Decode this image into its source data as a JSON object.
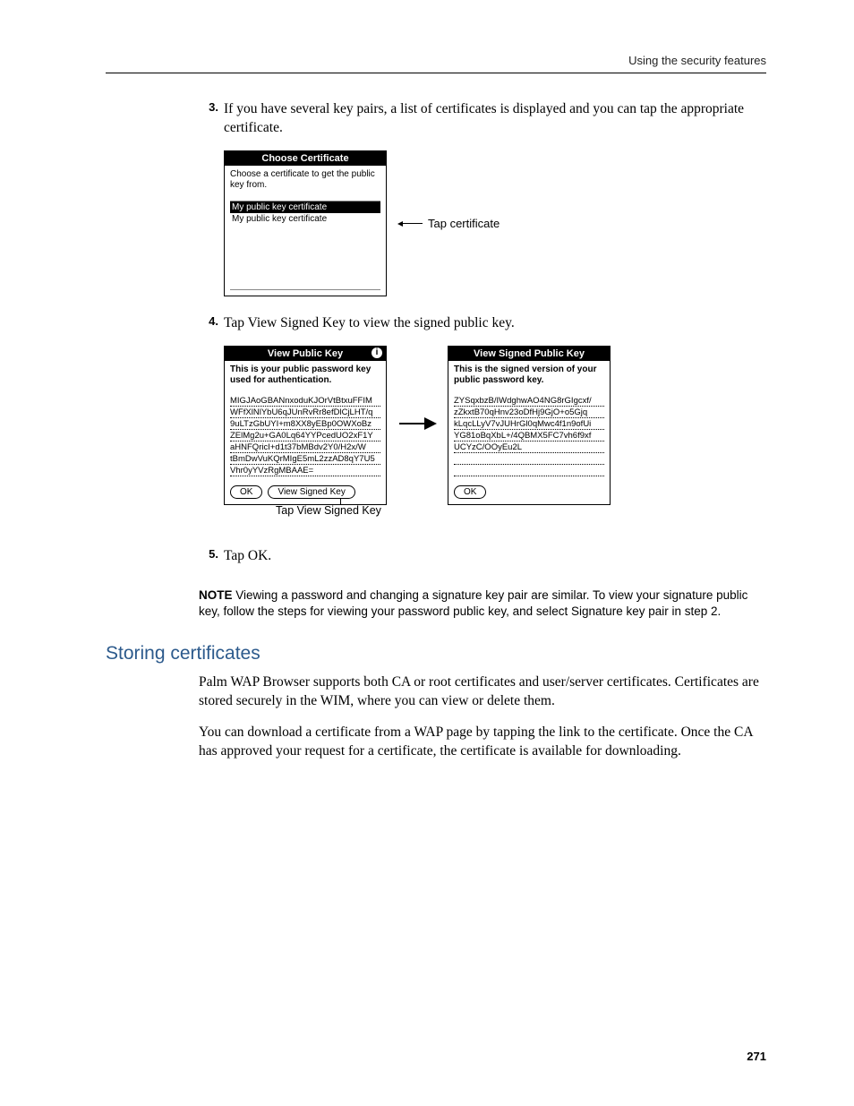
{
  "header": {
    "running": "Using the security features"
  },
  "steps": {
    "s3": {
      "num": "3.",
      "text": "If you have several key pairs, a list of certificates is displayed and you can tap the appropriate certificate."
    },
    "s4": {
      "num": "4.",
      "text": "Tap View Signed Key to view the signed public key."
    },
    "s5": {
      "num": "5.",
      "text": "Tap OK."
    }
  },
  "fig1": {
    "title": "Choose Certificate",
    "prompt": "Choose a certificate to get the public key from.",
    "items": [
      "My public key certificate",
      "My public key certificate"
    ],
    "callout": "Tap certificate"
  },
  "fig2a": {
    "title": "View Public Key",
    "prompt": "This is your public password key used for authentication.",
    "lines": [
      "MIGJAoGBANnxoduKJOrVtBtxuFFIM",
      "WFfXlNlYbU6qJUnRvRr8efDlCjLHT/q",
      "9uLTzGbUYI+m8XX8yEBp0OWXoBz",
      "ZElMg2u+GA0Lq64YYPcedUO2xF1Y",
      "aHNFQricI+d1t37bMBdv2Y0/H2x/W",
      "tBmDwVuKQrMIgE5mL2zzAD8qY7U5",
      "Vhr0yYVzRgMBAAE="
    ],
    "btn_ok": "OK",
    "btn_view": "View Signed Key"
  },
  "fig2b": {
    "title": "View Signed Public Key",
    "prompt": "This is the signed version of your public password key.",
    "lines": [
      "ZYSqxbzB/IWdghwAO4NG8rGIgcxf/",
      "zZkxtB70qHnv23oDfHj9GjO+o5Gjq",
      "kLqcLLyV7vJUHrGl0qMwc4f1n9ofUi",
      "YG81oBqXbL+/4QBMX5FC7vh6f9xf",
      "UCYzC/OOyEu2L"
    ],
    "btn_ok": "OK"
  },
  "fig2_caption": "Tap View Signed Key",
  "note": {
    "label": "NOTE",
    "text": "Viewing a password and changing a signature key pair are similar. To view your signature public key, follow the steps for viewing your password public key, and select Signature key pair in step 2."
  },
  "section": {
    "title": "Storing certificates",
    "p1": "Palm WAP Browser supports both CA or root certificates and user/server certificates. Certificates are stored securely in the WIM, where you can view or delete them.",
    "p2": "You can download a certificate from a WAP page by tapping the link to the certificate. Once the CA has approved your request for a certificate, the certificate is available for downloading."
  },
  "page_number": "271"
}
